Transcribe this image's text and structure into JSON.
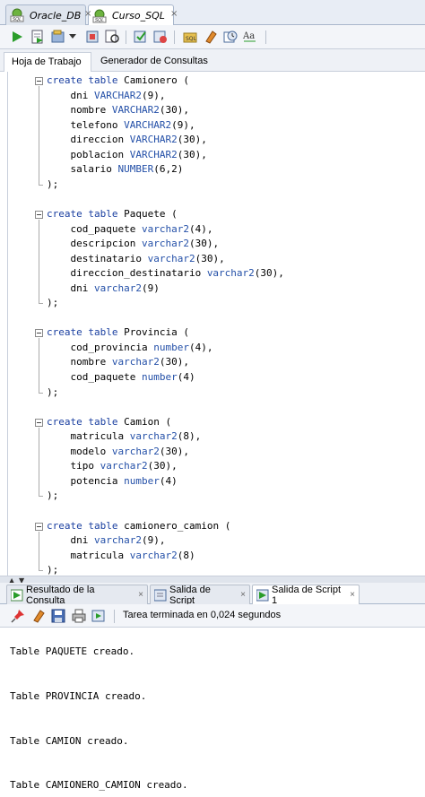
{
  "doc_tabs": [
    {
      "label": "Oracle_DB",
      "active": false
    },
    {
      "label": "Curso_SQL",
      "active": true
    }
  ],
  "sub_tabs": [
    {
      "label": "Hoja de Trabajo"
    },
    {
      "label": "Generador de Consultas"
    }
  ],
  "toolbar": {
    "icons": [
      "run-statement-icon",
      "run-script-icon",
      "sql-tuning-icon",
      "dropdown-arrow-icon",
      "autotrace-icon",
      "explain-plan-icon",
      "commit-icon",
      "rollback-icon",
      "unshared-sql-icon",
      "clear-icon",
      "history-icon",
      "format-case-icon"
    ]
  },
  "code": [
    {
      "kw": "create table",
      "rest": " Camionero ("
    },
    {
      "indent": "    ",
      "name": "dni",
      "type": "VARCHAR2",
      "args": "(9),"
    },
    {
      "indent": "    ",
      "name": "nombre",
      "type": "VARCHAR2",
      "args": "(30),"
    },
    {
      "indent": "    ",
      "name": "telefono",
      "type": "VARCHAR2",
      "args": "(9),"
    },
    {
      "indent": "    ",
      "name": "direccion",
      "type": "VARCHAR2",
      "args": "(30),"
    },
    {
      "indent": "    ",
      "name": "poblacion",
      "type": "VARCHAR2",
      "args": "(30),"
    },
    {
      "indent": "    ",
      "name": "salario",
      "type": "NUMBER",
      "args": "(6,2)"
    },
    {
      "plain": ");"
    },
    {
      "plain": ""
    },
    {
      "kw": "create table",
      "rest": " Paquete ("
    },
    {
      "indent": "    ",
      "name": "cod_paquete",
      "type": "varchar2",
      "args": "(4),"
    },
    {
      "indent": "    ",
      "name": "descripcion",
      "type": "varchar2",
      "args": "(30),"
    },
    {
      "indent": "    ",
      "name": "destinatario",
      "type": "varchar2",
      "args": "(30),"
    },
    {
      "indent": "    ",
      "name": "direccion_destinatario",
      "type": "varchar2",
      "args": "(30),"
    },
    {
      "indent": "    ",
      "name": "dni",
      "type": "varchar2",
      "args": "(9)"
    },
    {
      "plain": ");"
    },
    {
      "plain": ""
    },
    {
      "kw": "create table",
      "rest": " Provincia ("
    },
    {
      "indent": "    ",
      "name": "cod_provincia",
      "type": "number",
      "args": "(4),"
    },
    {
      "indent": "    ",
      "name": "nombre",
      "type": "varchar2",
      "args": "(30),"
    },
    {
      "indent": "    ",
      "name": "cod_paquete",
      "type": "number",
      "args": "(4)"
    },
    {
      "plain": ");"
    },
    {
      "plain": ""
    },
    {
      "kw": "create table",
      "rest": " Camion ("
    },
    {
      "indent": "    ",
      "name": "matricula",
      "type": "varchar2",
      "args": "(8),"
    },
    {
      "indent": "    ",
      "name": "modelo",
      "type": "varchar2",
      "args": "(30),"
    },
    {
      "indent": "    ",
      "name": "tipo",
      "type": "varchar2",
      "args": "(30),"
    },
    {
      "indent": "    ",
      "name": "potencia",
      "type": "number",
      "args": "(4)"
    },
    {
      "plain": ");"
    },
    {
      "plain": ""
    },
    {
      "kw": "create table",
      "rest": " camionero_camion ("
    },
    {
      "indent": "    ",
      "name": "dni",
      "type": "varchar2",
      "args": "(9),"
    },
    {
      "indent": "    ",
      "name": "matricula",
      "type": "varchar2",
      "args": "(8)"
    },
    {
      "plain": ");"
    }
  ],
  "output_tabs": [
    {
      "label": "Resultado de la Consulta",
      "close": "×"
    },
    {
      "label": "Salida de Script",
      "close": "×"
    },
    {
      "label": "Salida de Script 1",
      "close": "×"
    }
  ],
  "output_toolbar": {
    "status": "Tarea terminada en 0,024 segundos"
  },
  "output_lines": [
    "Table PAQUETE creado.",
    "Table PROVINCIA creado.",
    "Table CAMION creado.",
    "Table CAMIONERO_CAMION creado."
  ],
  "colors": {
    "keyword": "#1a3fa0",
    "type": "#2450a8",
    "accent_green": "#2a9d2a"
  }
}
